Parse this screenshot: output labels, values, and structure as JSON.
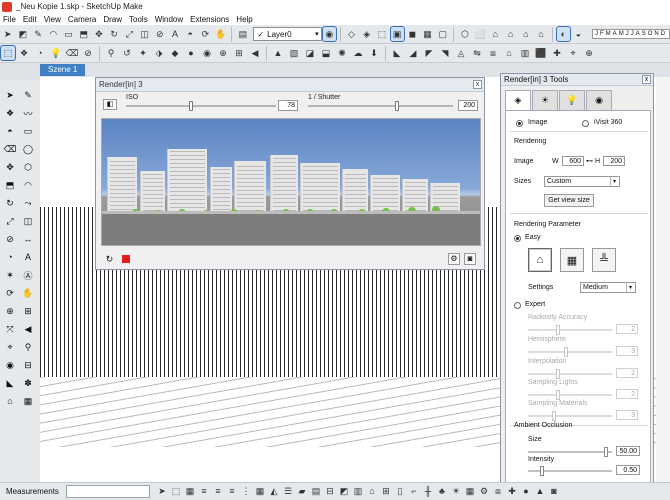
{
  "window": {
    "title": "_Neu Kopie 1.skp - SketchUp Make"
  },
  "menu": [
    "File",
    "Edit",
    "View",
    "Camera",
    "Draw",
    "Tools",
    "Window",
    "Extensions",
    "Help"
  ],
  "toolbar": {
    "layer_check": "✓",
    "layer_value": "Layer0",
    "months": [
      "J",
      "F",
      "M",
      "A",
      "M",
      "J",
      "J",
      "A",
      "S",
      "O",
      "N",
      "D"
    ]
  },
  "scene": {
    "tab_label": "Szene 1"
  },
  "render_window": {
    "title": "Render[in] 3",
    "iso_label": "ISO",
    "iso_value": "78",
    "iso_fraction": 0.43,
    "shutter_label": "1 / Shutter",
    "shutter_value": "200",
    "shutter_fraction": 0.62,
    "close": "x"
  },
  "tools_panel": {
    "title": "Render[in] 3 Tools",
    "close": "x",
    "output_image": "Image",
    "output_ivisit": "iVisit 360",
    "rendering_heading": "Rendering",
    "image_label": "Image",
    "w_label": "W",
    "w_value": "600",
    "h_label": "H",
    "h_value": "200",
    "sizes_label": "Sizes",
    "sizes_value": "Custom",
    "get_view_size": "Get view size",
    "param_heading": "Rendering Parameter",
    "easy_label": "Easy",
    "settings_label": "Settings",
    "settings_value": "Medium",
    "expert_label": "Expert",
    "expert_params": [
      {
        "label": "Radiosity Accuracy",
        "value": "2",
        "fraction": 0.35
      },
      {
        "label": "Hemisphere",
        "value": "3",
        "fraction": 0.45
      },
      {
        "label": "Interpolation",
        "value": "2",
        "fraction": 0.35
      },
      {
        "label": "Sampling Lights",
        "value": "2",
        "fraction": 0.35
      },
      {
        "label": "Sampling Materials",
        "value": "3",
        "fraction": 0.3
      }
    ],
    "ambient_heading": "Ambient Occlusion",
    "size_label": "Size",
    "size_value": "50.00",
    "size_fraction": 0.95,
    "intensity_label": "Intensity",
    "intensity_value": "0.50",
    "intensity_fraction": 0.15
  },
  "status": {
    "measurements_label": "Measurements"
  }
}
